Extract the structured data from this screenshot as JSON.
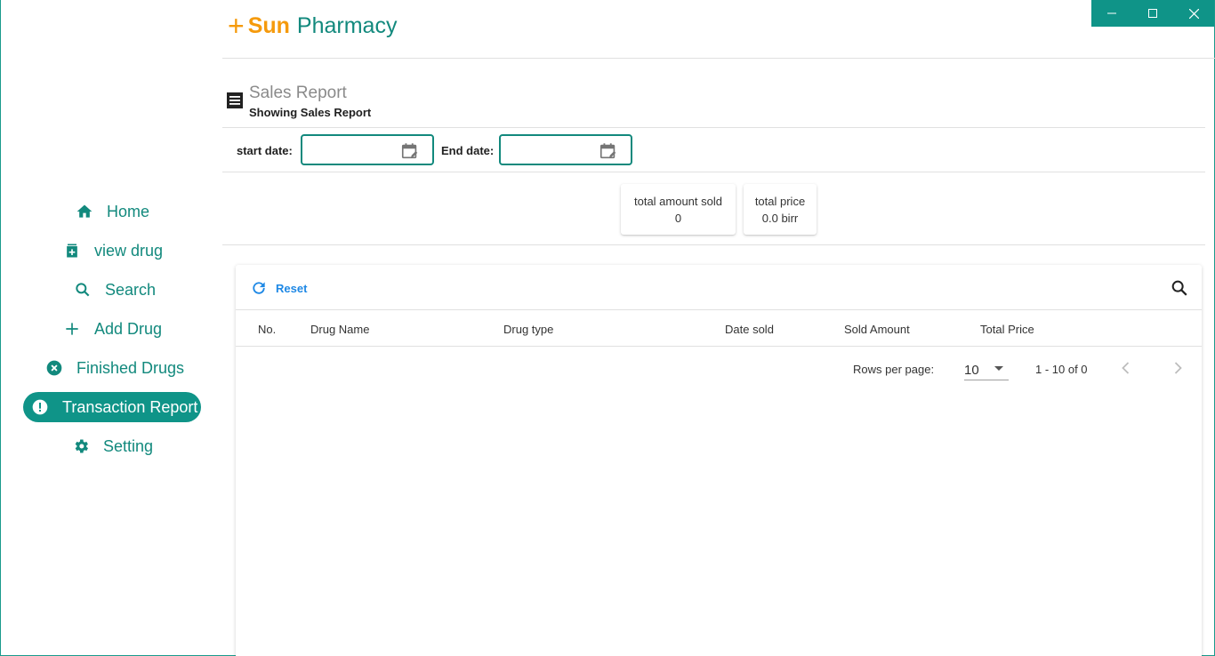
{
  "app": {
    "logo_plus": "+",
    "logo_brand": "Sun",
    "logo_rest": "Pharmacy"
  },
  "window_controls": {
    "minimize": "—",
    "maximize": "☐",
    "close": "✕"
  },
  "sidebar": {
    "items": [
      {
        "label": "Home",
        "icon": "home-icon"
      },
      {
        "label": "view drug",
        "icon": "medicine-box-icon"
      },
      {
        "label": "Search",
        "icon": "search-icon"
      },
      {
        "label": "Add Drug",
        "icon": "plus-icon"
      },
      {
        "label": "Finished Drugs",
        "icon": "cancel-circle-icon"
      },
      {
        "label": "Transaction Report",
        "icon": "alert-circle-icon",
        "active": true
      },
      {
        "label": "Setting",
        "icon": "gear-icon"
      }
    ]
  },
  "page": {
    "title": "Sales Report",
    "subtitle": "Showing Sales Report"
  },
  "filters": {
    "start_label": "start date:",
    "start_value": "",
    "end_label": "End date:",
    "end_value": ""
  },
  "stats": {
    "amount_label": "total amount sold",
    "amount_value": "0",
    "price_label": "total price",
    "price_value": "0.0 birr"
  },
  "table": {
    "reset_label": "Reset",
    "columns": [
      "No.",
      "Drug Name",
      "Drug type",
      "Date sold",
      "Sold Amount",
      "Total Price"
    ],
    "rows": [],
    "rows_per_page_label": "Rows per page:",
    "rows_per_page": "10",
    "range": "1 - 10 of 0"
  },
  "colors": {
    "primary": "#0f9488",
    "accent": "#f59a0c",
    "link": "#1e88e5"
  }
}
